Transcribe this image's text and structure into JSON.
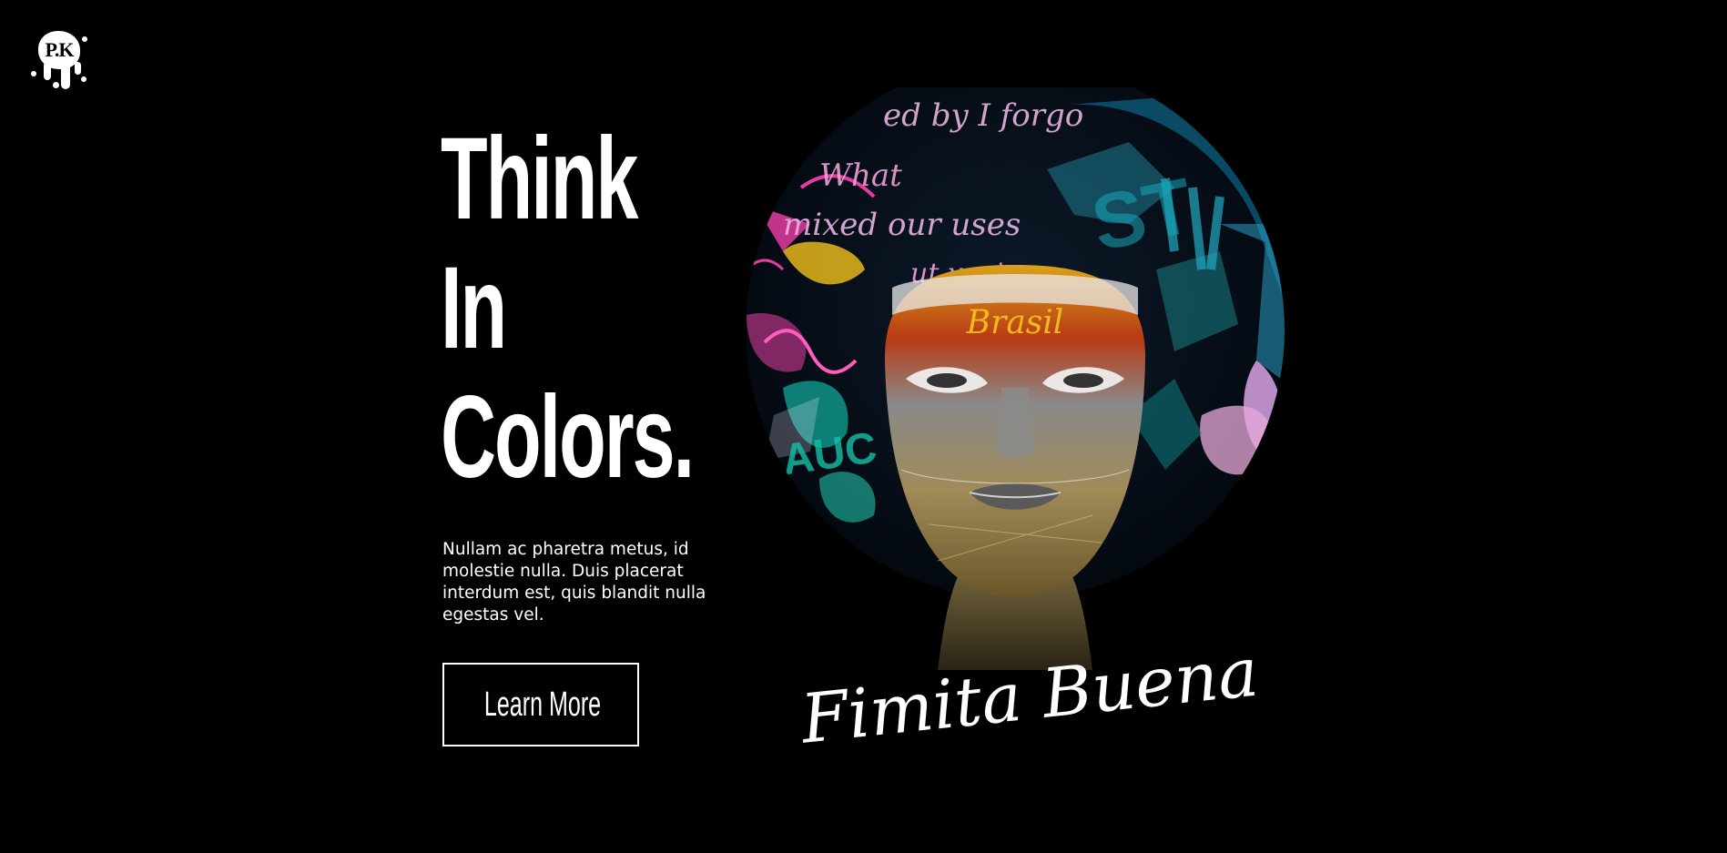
{
  "logo": {
    "text": "P.K"
  },
  "hero": {
    "headline": [
      "Think",
      "In",
      "Colors."
    ],
    "description": "Nullam ac pharetra metus, id molestie nulla. Duis placerat interdum est, quis blandit nulla egestas vel.",
    "cta_label": "Learn More"
  },
  "artwork": {
    "signature": "Fimita Buena",
    "graffiti": [
      "ed by I forgo",
      "What",
      "mixed our uses",
      "ut you'",
      "Brasil",
      "ST"
    ]
  },
  "colors": {
    "background": "#000000",
    "text": "#ffffff"
  }
}
